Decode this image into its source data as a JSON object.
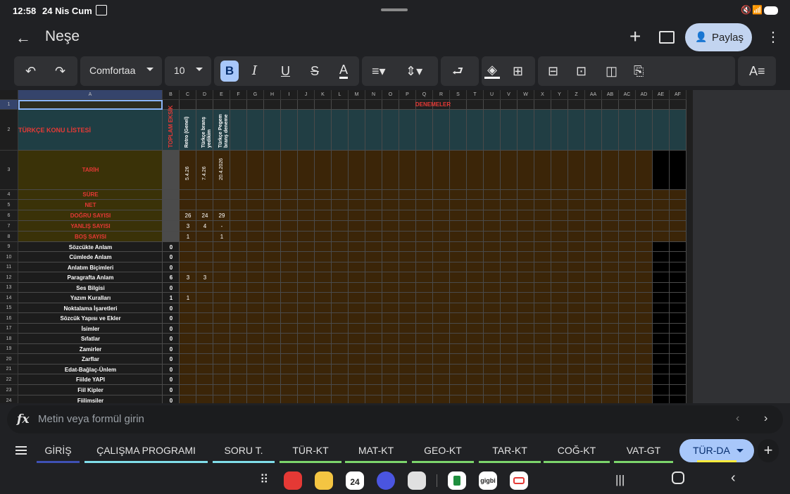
{
  "status_bar": {
    "time": "12:58",
    "date": "24 Nis Cum"
  },
  "app_bar": {
    "title": "Neşe",
    "share_label": "Paylaş"
  },
  "toolbar": {
    "font_name": "Comfortaa",
    "font_size": "10",
    "bold_label": "B",
    "italic_label": "I",
    "underline_label": "U",
    "strike_label": "S",
    "text_color_label": "A"
  },
  "sheet": {
    "col_headers": [
      "A",
      "B",
      "C",
      "D",
      "E",
      "F",
      "G",
      "H",
      "I",
      "J",
      "K",
      "L",
      "M",
      "N",
      "O",
      "P",
      "Q",
      "R",
      "S",
      "T",
      "U",
      "V",
      "W",
      "X",
      "Y",
      "Z",
      "AA",
      "AB",
      "AC",
      "AD",
      "AE",
      "AF"
    ],
    "row_headers": [
      "1",
      "2",
      "3",
      "4",
      "5",
      "6",
      "7",
      "8",
      "9",
      "10",
      "11",
      "12",
      "13",
      "14",
      "15",
      "16",
      "17",
      "18",
      "19",
      "20",
      "21",
      "22",
      "23",
      "24"
    ],
    "denemeler": "DENEMELER",
    "konu_title": "TÜRKÇE KONU LİSTESİ",
    "toplam_eksik": "TOPLAM EKSİK",
    "exam_names": [
      "Retro (Genel)",
      "Türkçe branş yedikim",
      "Türkçe Pegem branş deneme"
    ],
    "exam_dates": [
      "5.4.26",
      "7.4.26",
      "20.4.2026"
    ],
    "summary_labels": [
      "TARİH",
      "SÜRE",
      "NET",
      "DOĞRU SAYISI",
      "YANLIŞ SAYISI",
      "BOŞ SAYISI"
    ],
    "dogru": [
      "26",
      "24",
      "29"
    ],
    "yanlis": [
      "3",
      "4",
      "-"
    ],
    "bos": [
      "1",
      "",
      "1"
    ],
    "topics": [
      {
        "name": "Sözcükte Anlam",
        "total": "0",
        "c": "",
        "d": ""
      },
      {
        "name": "Cümlede Anlam",
        "total": "0",
        "c": "",
        "d": ""
      },
      {
        "name": "Anlatım Biçimleri",
        "total": "0",
        "c": "",
        "d": ""
      },
      {
        "name": "Paragrafta Anlam",
        "total": "6",
        "c": "3",
        "d": "3"
      },
      {
        "name": "Ses Bilgisi",
        "total": "0",
        "c": "",
        "d": ""
      },
      {
        "name": "Yazım Kuralları",
        "total": "1",
        "c": "1",
        "d": ""
      },
      {
        "name": "Noktalama İşaretleri",
        "total": "0",
        "c": "",
        "d": ""
      },
      {
        "name": "Sözcük Yapısı ve Ekler",
        "total": "0",
        "c": "",
        "d": ""
      },
      {
        "name": "İsimler",
        "total": "0",
        "c": "",
        "d": ""
      },
      {
        "name": "Sıfatlar",
        "total": "0",
        "c": "",
        "d": ""
      },
      {
        "name": "Zamirler",
        "total": "0",
        "c": "",
        "d": ""
      },
      {
        "name": "Zarflar",
        "total": "0",
        "c": "",
        "d": ""
      },
      {
        "name": "Edat-Bağlaç-Ünlem",
        "total": "0",
        "c": "",
        "d": ""
      },
      {
        "name": "Fiilde YAPI",
        "total": "0",
        "c": "",
        "d": ""
      },
      {
        "name": "Fiil Kipler",
        "total": "0",
        "c": "",
        "d": ""
      },
      {
        "name": "Fiilimsiler",
        "total": "0",
        "c": "",
        "d": ""
      }
    ]
  },
  "formula_bar": {
    "placeholder": "Metin veya formül girin"
  },
  "sheet_tabs": [
    {
      "label": "GİRİŞ",
      "color": "#3f51b5"
    },
    {
      "label": "ÇALIŞMA PROGRAMI",
      "color": "#80deea"
    },
    {
      "label": "SORU T.",
      "color": "#80deea"
    },
    {
      "label": "TÜR-KT",
      "color": "#7cd56b"
    },
    {
      "label": "MAT-KT",
      "color": "#7cd56b"
    },
    {
      "label": "GEO-KT",
      "color": "#7cd56b"
    },
    {
      "label": "TAR-KT",
      "color": "#7cd56b"
    },
    {
      "label": "COĞ-KT",
      "color": "#7cd56b"
    },
    {
      "label": "VAT-GT",
      "color": "#7cd56b"
    }
  ],
  "active_tab": {
    "label": "TÜR-DA"
  },
  "dock": {
    "calendar_day": "24",
    "calendar_month": "CUM",
    "gigbi_label": "gigbi"
  }
}
